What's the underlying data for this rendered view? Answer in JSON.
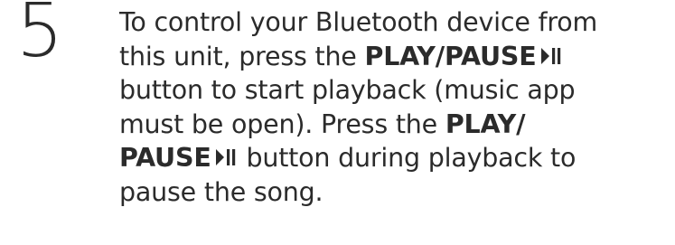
{
  "step": {
    "number": "5"
  },
  "instruction": {
    "line1": "To control your Bluetooth device from",
    "line2_pre": "this unit, press the ",
    "line2_bold": "PLAY/PAUSE",
    "line3": "button to start playback (music app",
    "line4_pre": "must be open). Press the ",
    "line4_bold": "PLAY/",
    "line5_bold": "PAUSE",
    "line5_post": " button during playback to",
    "line6": "pause the song."
  },
  "icons": {
    "play_pause": "play-pause-icon"
  }
}
